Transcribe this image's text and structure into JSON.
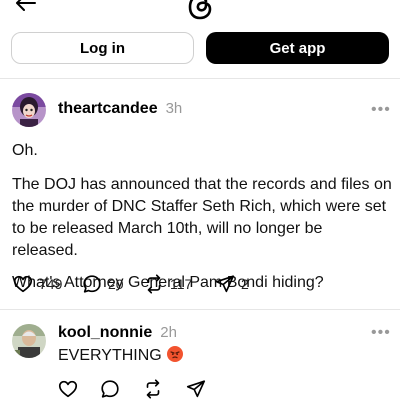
{
  "header": {
    "back_icon": "arrow-left-icon",
    "logo_icon": "threads-logo-icon",
    "login_label": "Log in",
    "getapp_label": "Get app"
  },
  "post": {
    "username": "theartcandee",
    "time": "3h",
    "more": "•••",
    "paragraphs": [
      "Oh.",
      "The DOJ has announced that the records and files on the murder of DNC Staffer Seth Rich, which were set to be released March 10th, will no longer be released.",
      "What's Attorney General Pam Bondi hiding?"
    ],
    "actions": {
      "likes": "749",
      "replies": "20",
      "reposts": "117",
      "shares": "2"
    }
  },
  "reply": {
    "username": "kool_nonnie",
    "time": "2h",
    "more": "•••",
    "text": "EVERYTHING",
    "emoji": "angry-face-emoji"
  },
  "colors": {
    "accent_dark": "#000000",
    "muted": "#999999",
    "divider": "#e6e6e6",
    "emoji_red": "#f2532e"
  }
}
